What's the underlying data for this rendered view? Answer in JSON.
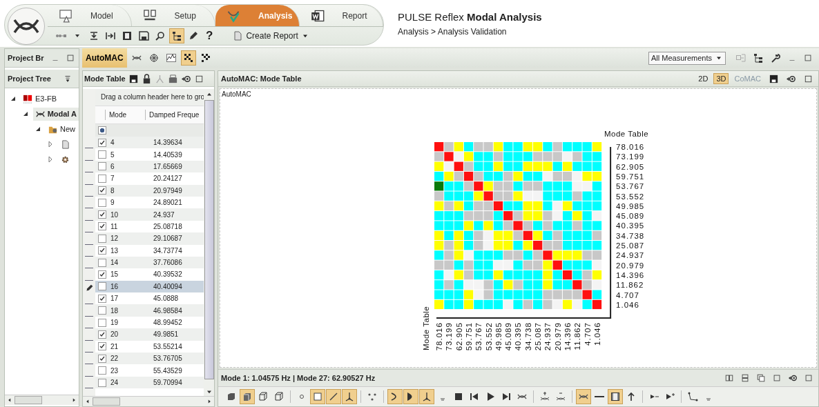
{
  "app": {
    "title": "PULSE Reflex **Modal Analysis**",
    "breadcrumb": "Analysis > Analysis Validation"
  },
  "ribbon_tabs": [
    {
      "label": "Model",
      "kind": "model",
      "selected": false
    },
    {
      "label": "Setup",
      "kind": "setup",
      "selected": false
    },
    {
      "label": "Analysis",
      "kind": "analysis",
      "selected": true
    },
    {
      "label": "Report",
      "kind": "report",
      "selected": false
    }
  ],
  "ribbon_tools": [
    {
      "kind": "sequence",
      "selected": false
    },
    {
      "kind": "caret",
      "selected": false
    },
    {
      "kind": "download",
      "selected": false
    },
    {
      "kind": "import",
      "selected": false
    },
    {
      "kind": "film",
      "selected": false
    },
    {
      "kind": "save",
      "selected": false
    },
    {
      "kind": "magnifier",
      "selected": false
    },
    {
      "kind": "tree",
      "selected": true
    },
    {
      "kind": "pencil",
      "selected": false
    }
  ],
  "help_glyph": "?",
  "create_report": {
    "label": "Create Report"
  },
  "project_browser": {
    "title": "Project Br",
    "tree_title": "Project Tree",
    "tree": [
      {
        "label": "E3-FB",
        "kind": "project",
        "expanded": true,
        "selected": false,
        "children": [
          {
            "label": "Modal A",
            "kind": "modal",
            "expanded": true,
            "selected": true,
            "children": [
              {
                "label": "New",
                "kind": "folder",
                "expanded": true,
                "selected": false,
                "children": [
                  {
                    "kind": "page",
                    "expanded": false,
                    "selected": false
                  },
                  {
                    "kind": "gear",
                    "expanded": false,
                    "selected": false
                  }
                ]
              }
            ]
          }
        ]
      }
    ]
  },
  "automac_tab": {
    "label": "AutoMAC",
    "selected": true
  },
  "automac_tools": [
    {
      "kind": "mode-shape",
      "selected": false
    },
    {
      "kind": "snowflake",
      "selected": false
    },
    {
      "kind": "chart",
      "selected": false
    },
    {
      "kind": "matrix",
      "selected": true
    },
    {
      "kind": "small-matrix",
      "selected": false
    }
  ],
  "measurement_select": {
    "value": "All Measurements"
  },
  "mode_table": {
    "title": "Mode Table",
    "group_hint": "Drag a column header here to gro",
    "columns": [
      "Mode",
      "Damped Freque"
    ],
    "select_all": {
      "indeterminate": true
    },
    "rows": [
      {
        "mode": "4",
        "frequency": "14.39634",
        "checked": true,
        "selected": false
      },
      {
        "mode": "5",
        "frequency": "14.40539",
        "checked": false,
        "selected": false
      },
      {
        "mode": "6",
        "frequency": "17.65669",
        "checked": false,
        "selected": false
      },
      {
        "mode": "7",
        "frequency": "20.24127",
        "checked": false,
        "selected": false
      },
      {
        "mode": "8",
        "frequency": "20.97949",
        "checked": true,
        "selected": false
      },
      {
        "mode": "9",
        "frequency": "24.89021",
        "checked": false,
        "selected": false
      },
      {
        "mode": "10",
        "frequency": "24.937",
        "checked": true,
        "selected": false
      },
      {
        "mode": "11",
        "frequency": "25.08718",
        "checked": true,
        "selected": false
      },
      {
        "mode": "12",
        "frequency": "29.10687",
        "checked": false,
        "selected": false
      },
      {
        "mode": "13",
        "frequency": "34.73774",
        "checked": true,
        "selected": false
      },
      {
        "mode": "14",
        "frequency": "37.76086",
        "checked": false,
        "selected": false
      },
      {
        "mode": "15",
        "frequency": "40.39532",
        "checked": true,
        "selected": false
      },
      {
        "mode": "16",
        "frequency": "40.40094",
        "checked": false,
        "selected": true
      },
      {
        "mode": "17",
        "frequency": "45.0888",
        "checked": true,
        "selected": false
      },
      {
        "mode": "18",
        "frequency": "46.98584",
        "checked": false,
        "selected": false
      },
      {
        "mode": "19",
        "frequency": "48.99452",
        "checked": false,
        "selected": false
      },
      {
        "mode": "20",
        "frequency": "49.9851",
        "checked": true,
        "selected": false
      },
      {
        "mode": "21",
        "frequency": "53.55214",
        "checked": true,
        "selected": false
      },
      {
        "mode": "22",
        "frequency": "53.76705",
        "checked": true,
        "selected": false
      },
      {
        "mode": "23",
        "frequency": "55.43529",
        "checked": false,
        "selected": false
      },
      {
        "mode": "24",
        "frequency": "59.70994",
        "checked": false,
        "selected": false
      }
    ]
  },
  "view": {
    "title": "AutoMAC: Mode Table",
    "modes": [
      {
        "label": "2D",
        "selected": false,
        "disabled": false
      },
      {
        "label": "3D",
        "selected": true,
        "disabled": false
      },
      {
        "label": "CoMAC",
        "selected": false,
        "disabled": true
      }
    ],
    "canvas_label": "AutoMAC",
    "mac_matrix": {
      "title": "Mode Table",
      "axis_label": "Mode Table",
      "row_labels": [
        "78.016",
        "73.199",
        "62.905",
        "59.751",
        "53.767",
        "53.552",
        "49.985",
        "45.089",
        "40.395",
        "34.738",
        "25.087",
        "24.937",
        "20.979",
        "14.396",
        "11.862",
        "4.707",
        "1.046"
      ],
      "column_labels": [
        "78.016",
        "73.199",
        "62.905",
        "59.751",
        "53.767",
        "53.552",
        "49.985",
        "45.089",
        "40.395",
        "34.738",
        "25.087",
        "24.937",
        "20.979",
        "14.396",
        "11.862",
        "4.707",
        "1.046"
      ],
      "rows": [
        {
          "cells": [
            {
              "color": "#ff1010"
            },
            {
              "color": "#c8c8c8"
            },
            {
              "color": "#ffff00"
            },
            {
              "color": "#00ffff"
            },
            {
              "color": "#c8c8c8"
            },
            {
              "color": "#c8c8c8"
            },
            {
              "color": "#ffff00"
            },
            {
              "color": "#00ffff"
            },
            {
              "color": "#00ffff"
            },
            {
              "color": "#ffff00"
            },
            {
              "color": "#ffff00"
            },
            {
              "color": "#00ffff"
            },
            {
              "color": "#c8c8c8"
            },
            {
              "color": "#00ffff"
            },
            {
              "color": "#00ffff"
            },
            {
              "color": "#00ffff"
            },
            {
              "color": "#ffff00"
            }
          ]
        },
        {
          "cells": [
            {
              "color": "#c8c8c8"
            },
            {
              "color": "#ff1010"
            },
            {
              "color": "#f4f4f4"
            },
            {
              "color": "#ffff00"
            },
            {
              "color": "#00ffff"
            },
            {
              "color": "#00ffff"
            },
            {
              "color": "#c8c8c8"
            },
            {
              "color": "#00ffff"
            },
            {
              "color": "#00ffff"
            },
            {
              "color": "#00ffff"
            },
            {
              "color": "#c8c8c8"
            },
            {
              "color": "#c8c8c8"
            },
            {
              "color": "#c8c8c8"
            },
            {
              "color": "#f4f4f4"
            },
            {
              "color": "#c8c8c8"
            },
            {
              "color": "#00ffff"
            },
            {
              "color": "#00ffff"
            }
          ]
        },
        {
          "cells": [
            {
              "color": "#ffff00"
            },
            {
              "color": "#f4f4f4"
            },
            {
              "color": "#ff1010"
            },
            {
              "color": "#c8c8c8"
            },
            {
              "color": "#00ffff"
            },
            {
              "color": "#00ffff"
            },
            {
              "color": "#ffff00"
            },
            {
              "color": "#00ffff"
            },
            {
              "color": "#00ffff"
            },
            {
              "color": "#ffff00"
            },
            {
              "color": "#ffff00"
            },
            {
              "color": "#ffff00"
            },
            {
              "color": "#00ffff"
            },
            {
              "color": "#ffff00"
            },
            {
              "color": "#00ffff"
            },
            {
              "color": "#00ffff"
            },
            {
              "color": "#00ffff"
            }
          ]
        },
        {
          "cells": [
            {
              "color": "#00ffff"
            },
            {
              "color": "#ffff00"
            },
            {
              "color": "#c8c8c8"
            },
            {
              "color": "#ff1010"
            },
            {
              "color": "#c8c8c8"
            },
            {
              "color": "#00ffff"
            },
            {
              "color": "#00ffff"
            },
            {
              "color": "#c8c8c8"
            },
            {
              "color": "#ffff00"
            },
            {
              "color": "#00ffff"
            },
            {
              "color": "#00ffff"
            },
            {
              "color": "#f4f4f4"
            },
            {
              "color": "#c8c8c8"
            },
            {
              "color": "#c8c8c8"
            },
            {
              "color": "#f4f4f4"
            },
            {
              "color": "#ffff00"
            },
            {
              "color": "#ffff00"
            }
          ]
        },
        {
          "cells": [
            {
              "color": "#0a7a0a"
            },
            {
              "color": "#00ffff"
            },
            {
              "color": "#00ffff"
            },
            {
              "color": "#c8c8c8"
            },
            {
              "color": "#ff1010"
            },
            {
              "color": "#ffff00"
            },
            {
              "color": "#c8c8c8"
            },
            {
              "color": "#c8c8c8"
            },
            {
              "color": "#00ffff"
            },
            {
              "color": "#c8c8c8"
            },
            {
              "color": "#c8c8c8"
            },
            {
              "color": "#00ffff"
            },
            {
              "color": "#00ffff"
            },
            {
              "color": "#00ffff"
            },
            {
              "color": "#f4f4f4"
            },
            {
              "color": "#f4f4f4"
            },
            {
              "color": "#00ffff"
            }
          ]
        },
        {
          "cells": [
            {
              "color": "#c8c8c8"
            },
            {
              "color": "#00ffff"
            },
            {
              "color": "#00ffff"
            },
            {
              "color": "#00ffff"
            },
            {
              "color": "#ffff00"
            },
            {
              "color": "#ff1010"
            },
            {
              "color": "#c8c8c8"
            },
            {
              "color": "#c8c8c8"
            },
            {
              "color": "#ffff00"
            },
            {
              "color": "#f4f4f4"
            },
            {
              "color": "#f4f4f4"
            },
            {
              "color": "#00ffff"
            },
            {
              "color": "#00ffff"
            },
            {
              "color": "#00ffff"
            },
            {
              "color": "#c8c8c8"
            },
            {
              "color": "#00ffff"
            },
            {
              "color": "#00ffff"
            }
          ]
        },
        {
          "cells": [
            {
              "color": "#ffff00"
            },
            {
              "color": "#c8c8c8"
            },
            {
              "color": "#ffff00"
            },
            {
              "color": "#00ffff"
            },
            {
              "color": "#c8c8c8"
            },
            {
              "color": "#c8c8c8"
            },
            {
              "color": "#ff1010"
            },
            {
              "color": "#00ffff"
            },
            {
              "color": "#00ffff"
            },
            {
              "color": "#ffff00"
            },
            {
              "color": "#ffff00"
            },
            {
              "color": "#00ffff"
            },
            {
              "color": "#f4f4f4"
            },
            {
              "color": "#ffff00"
            },
            {
              "color": "#00ffff"
            },
            {
              "color": "#00ffff"
            },
            {
              "color": "#00ffff"
            }
          ]
        },
        {
          "cells": [
            {
              "color": "#00ffff"
            },
            {
              "color": "#00ffff"
            },
            {
              "color": "#00ffff"
            },
            {
              "color": "#c8c8c8"
            },
            {
              "color": "#c8c8c8"
            },
            {
              "color": "#c8c8c8"
            },
            {
              "color": "#00ffff"
            },
            {
              "color": "#ff1010"
            },
            {
              "color": "#c8c8c8"
            },
            {
              "color": "#ffff00"
            },
            {
              "color": "#ffff00"
            },
            {
              "color": "#c8c8c8"
            },
            {
              "color": "#f4f4f4"
            },
            {
              "color": "#00ffff"
            },
            {
              "color": "#ffff00"
            },
            {
              "color": "#00ffff"
            },
            {
              "color": "#f4f4f4"
            }
          ]
        },
        {
          "cells": [
            {
              "color": "#00ffff"
            },
            {
              "color": "#00ffff"
            },
            {
              "color": "#00ffff"
            },
            {
              "color": "#ffff00"
            },
            {
              "color": "#00ffff"
            },
            {
              "color": "#ffff00"
            },
            {
              "color": "#00ffff"
            },
            {
              "color": "#c8c8c8"
            },
            {
              "color": "#ff1010"
            },
            {
              "color": "#c8c8c8"
            },
            {
              "color": "#00ffff"
            },
            {
              "color": "#c8c8c8"
            },
            {
              "color": "#00ffff"
            },
            {
              "color": "#00ffff"
            },
            {
              "color": "#c8c8c8"
            },
            {
              "color": "#00ffff"
            },
            {
              "color": "#00ffff"
            }
          ]
        },
        {
          "cells": [
            {
              "color": "#ffff00"
            },
            {
              "color": "#00ffff"
            },
            {
              "color": "#ffff00"
            },
            {
              "color": "#00ffff"
            },
            {
              "color": "#c8c8c8"
            },
            {
              "color": "#f4f4f4"
            },
            {
              "color": "#ffff00"
            },
            {
              "color": "#ffff00"
            },
            {
              "color": "#c8c8c8"
            },
            {
              "color": "#ff1010"
            },
            {
              "color": "#ffff00"
            },
            {
              "color": "#00ffff"
            },
            {
              "color": "#c8c8c8"
            },
            {
              "color": "#00ffff"
            },
            {
              "color": "#00ffff"
            },
            {
              "color": "#00ffff"
            },
            {
              "color": "#c8c8c8"
            }
          ]
        },
        {
          "cells": [
            {
              "color": "#ffff00"
            },
            {
              "color": "#c8c8c8"
            },
            {
              "color": "#ffff00"
            },
            {
              "color": "#00ffff"
            },
            {
              "color": "#c8c8c8"
            },
            {
              "color": "#f4f4f4"
            },
            {
              "color": "#ffff00"
            },
            {
              "color": "#ffff00"
            },
            {
              "color": "#00ffff"
            },
            {
              "color": "#ffff00"
            },
            {
              "color": "#ff1010"
            },
            {
              "color": "#c8c8c8"
            },
            {
              "color": "#c8c8c8"
            },
            {
              "color": "#00ffff"
            },
            {
              "color": "#00ffff"
            },
            {
              "color": "#00ffff"
            },
            {
              "color": "#00ffff"
            }
          ]
        },
        {
          "cells": [
            {
              "color": "#00ffff"
            },
            {
              "color": "#c8c8c8"
            },
            {
              "color": "#ffff00"
            },
            {
              "color": "#f4f4f4"
            },
            {
              "color": "#00ffff"
            },
            {
              "color": "#00ffff"
            },
            {
              "color": "#00ffff"
            },
            {
              "color": "#c8c8c8"
            },
            {
              "color": "#c8c8c8"
            },
            {
              "color": "#00ffff"
            },
            {
              "color": "#c8c8c8"
            },
            {
              "color": "#ff1010"
            },
            {
              "color": "#ffff00"
            },
            {
              "color": "#ffff00"
            },
            {
              "color": "#ffff00"
            },
            {
              "color": "#c8c8c8"
            },
            {
              "color": "#c8c8c8"
            }
          ]
        },
        {
          "cells": [
            {
              "color": "#c8c8c8"
            },
            {
              "color": "#c8c8c8"
            },
            {
              "color": "#00ffff"
            },
            {
              "color": "#c8c8c8"
            },
            {
              "color": "#00ffff"
            },
            {
              "color": "#00ffff"
            },
            {
              "color": "#f4f4f4"
            },
            {
              "color": "#f4f4f4"
            },
            {
              "color": "#00ffff"
            },
            {
              "color": "#c8c8c8"
            },
            {
              "color": "#c8c8c8"
            },
            {
              "color": "#ffff00"
            },
            {
              "color": "#ff1010"
            },
            {
              "color": "#00ffff"
            },
            {
              "color": "#00ffff"
            },
            {
              "color": "#00ffff"
            },
            {
              "color": "#f4f4f4"
            }
          ]
        },
        {
          "cells": [
            {
              "color": "#00ffff"
            },
            {
              "color": "#f4f4f4"
            },
            {
              "color": "#ffff00"
            },
            {
              "color": "#c8c8c8"
            },
            {
              "color": "#00ffff"
            },
            {
              "color": "#00ffff"
            },
            {
              "color": "#ffff00"
            },
            {
              "color": "#00ffff"
            },
            {
              "color": "#00ffff"
            },
            {
              "color": "#00ffff"
            },
            {
              "color": "#00ffff"
            },
            {
              "color": "#ffff00"
            },
            {
              "color": "#00ffff"
            },
            {
              "color": "#ff1010"
            },
            {
              "color": "#00ffff"
            },
            {
              "color": "#c8c8c8"
            },
            {
              "color": "#ffff00"
            }
          ]
        },
        {
          "cells": [
            {
              "color": "#00ffff"
            },
            {
              "color": "#c8c8c8"
            },
            {
              "color": "#00ffff"
            },
            {
              "color": "#f4f4f4"
            },
            {
              "color": "#f4f4f4"
            },
            {
              "color": "#c8c8c8"
            },
            {
              "color": "#00ffff"
            },
            {
              "color": "#ffff00"
            },
            {
              "color": "#c8c8c8"
            },
            {
              "color": "#00ffff"
            },
            {
              "color": "#00ffff"
            },
            {
              "color": "#ffff00"
            },
            {
              "color": "#00ffff"
            },
            {
              "color": "#00ffff"
            },
            {
              "color": "#ff1010"
            },
            {
              "color": "#c8c8c8"
            },
            {
              "color": "#f4f4f4"
            }
          ]
        },
        {
          "cells": [
            {
              "color": "#00ffff"
            },
            {
              "color": "#00ffff"
            },
            {
              "color": "#00ffff"
            },
            {
              "color": "#ffff00"
            },
            {
              "color": "#f4f4f4"
            },
            {
              "color": "#c8c8c8"
            },
            {
              "color": "#00ffff"
            },
            {
              "color": "#00ffff"
            },
            {
              "color": "#00ffff"
            },
            {
              "color": "#00ffff"
            },
            {
              "color": "#00ffff"
            },
            {
              "color": "#c8c8c8"
            },
            {
              "color": "#c8c8c8"
            },
            {
              "color": "#c8c8c8"
            },
            {
              "color": "#c8c8c8"
            },
            {
              "color": "#ff1010"
            },
            {
              "color": "#00ffff"
            }
          ]
        },
        {
          "cells": [
            {
              "color": "#ffff00"
            },
            {
              "color": "#00ffff"
            },
            {
              "color": "#00ffff"
            },
            {
              "color": "#ffff00"
            },
            {
              "color": "#00ffff"
            },
            {
              "color": "#00ffff"
            },
            {
              "color": "#00ffff"
            },
            {
              "color": "#f4f4f4"
            },
            {
              "color": "#00ffff"
            },
            {
              "color": "#c8c8c8"
            },
            {
              "color": "#00ffff"
            },
            {
              "color": "#c8c8c8"
            },
            {
              "color": "#f4f4f4"
            },
            {
              "color": "#ffff00"
            },
            {
              "color": "#f4f4f4"
            },
            {
              "color": "#00ffff"
            },
            {
              "color": "#ff1010"
            }
          ]
        }
      ]
    },
    "status": "Mode 1: 1.04575 Hz | Mode 27: 62.90527 Hz"
  },
  "bottom_tools": [
    {
      "kind": "solid-cube",
      "selected": false
    },
    {
      "kind": "shaded-cube",
      "selected": true
    },
    {
      "kind": "wire-cube",
      "selected": false
    },
    {
      "kind": "outline-cube",
      "selected": false
    },
    {
      "kind": "sep"
    },
    {
      "kind": "dot",
      "selected": false
    },
    {
      "kind": "square",
      "selected": true
    },
    {
      "kind": "line",
      "selected": true
    },
    {
      "kind": "axes",
      "selected": true
    },
    {
      "kind": "sep"
    },
    {
      "kind": "numbering",
      "selected": false
    },
    {
      "kind": "sep"
    },
    {
      "kind": "curve",
      "selected": true
    },
    {
      "kind": "half-disc",
      "selected": true
    },
    {
      "kind": "axes",
      "selected": true
    },
    {
      "kind": "more",
      "selected": false
    },
    {
      "kind": "stop",
      "selected": false
    },
    {
      "kind": "skip-back",
      "selected": false
    },
    {
      "kind": "play",
      "selected": false
    },
    {
      "kind": "skip-forward",
      "selected": false
    },
    {
      "kind": "mode-shape",
      "selected": false
    },
    {
      "kind": "sep"
    },
    {
      "kind": "plus-shape",
      "selected": false
    },
    {
      "kind": "minus-shape",
      "selected": false
    },
    {
      "kind": "sep"
    },
    {
      "kind": "mode-shape",
      "selected": true
    },
    {
      "kind": "dash",
      "selected": false
    },
    {
      "kind": "gradient",
      "selected": true
    },
    {
      "kind": "up-arrow",
      "selected": false
    },
    {
      "kind": "sep"
    },
    {
      "kind": "step-back",
      "selected": false
    },
    {
      "kind": "step-forward",
      "selected": false
    },
    {
      "kind": "sep"
    },
    {
      "kind": "polyline",
      "selected": false
    },
    {
      "kind": "more",
      "selected": false
    }
  ]
}
